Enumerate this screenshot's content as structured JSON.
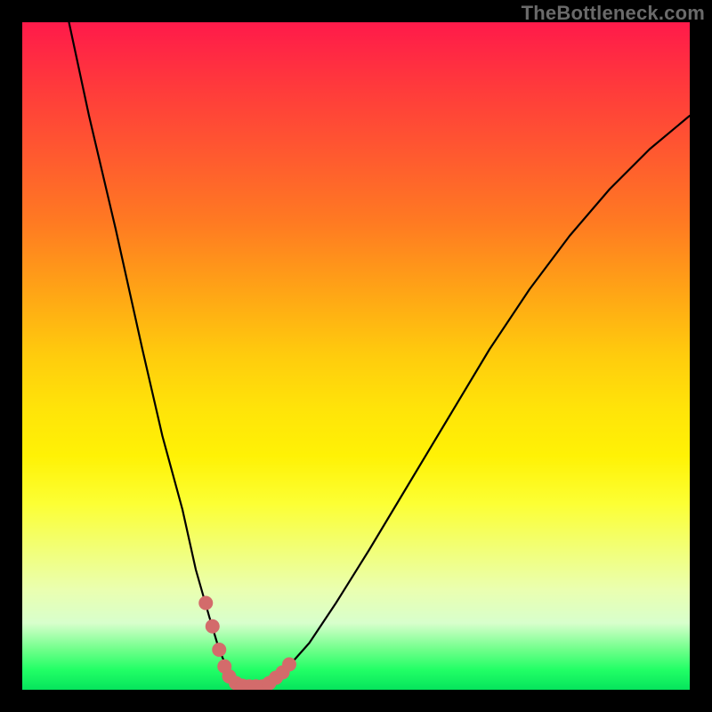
{
  "watermark": "TheBottleneck.com",
  "chart_data": {
    "type": "line",
    "title": "",
    "xlabel": "",
    "ylabel": "",
    "xlim": [
      0,
      100
    ],
    "ylim": [
      0,
      100
    ],
    "grid": false,
    "legend": false,
    "series": [
      {
        "name": "curve",
        "x": [
          7,
          10,
          14,
          18,
          21,
          24,
          26,
          28,
          29.5,
          31,
          32.5,
          34,
          36,
          39,
          43,
          47,
          52,
          58,
          64,
          70,
          76,
          82,
          88,
          94,
          100
        ],
        "values": [
          100,
          86,
          69,
          51,
          38,
          27,
          18,
          11,
          6,
          2.5,
          1,
          0.5,
          0.5,
          2.5,
          7,
          13,
          21,
          31,
          41,
          51,
          60,
          68,
          75,
          81,
          86
        ]
      }
    ],
    "marked_points": {
      "name": "highlight-dots",
      "x": [
        27.5,
        28.5,
        29.5,
        30.3,
        31,
        32,
        33,
        34,
        35,
        36,
        37,
        38,
        39,
        40
      ],
      "values": [
        13,
        9.5,
        6,
        3.5,
        2,
        1,
        0.6,
        0.5,
        0.5,
        0.5,
        1,
        1.8,
        2.6,
        3.8
      ]
    },
    "gradient_stops": [
      {
        "pos": 0.0,
        "color": "#ff1a4a"
      },
      {
        "pos": 0.5,
        "color": "#ffcc0d"
      },
      {
        "pos": 0.72,
        "color": "#fcff33"
      },
      {
        "pos": 0.9,
        "color": "#d8ffcc"
      },
      {
        "pos": 1.0,
        "color": "#06e45c"
      }
    ]
  }
}
